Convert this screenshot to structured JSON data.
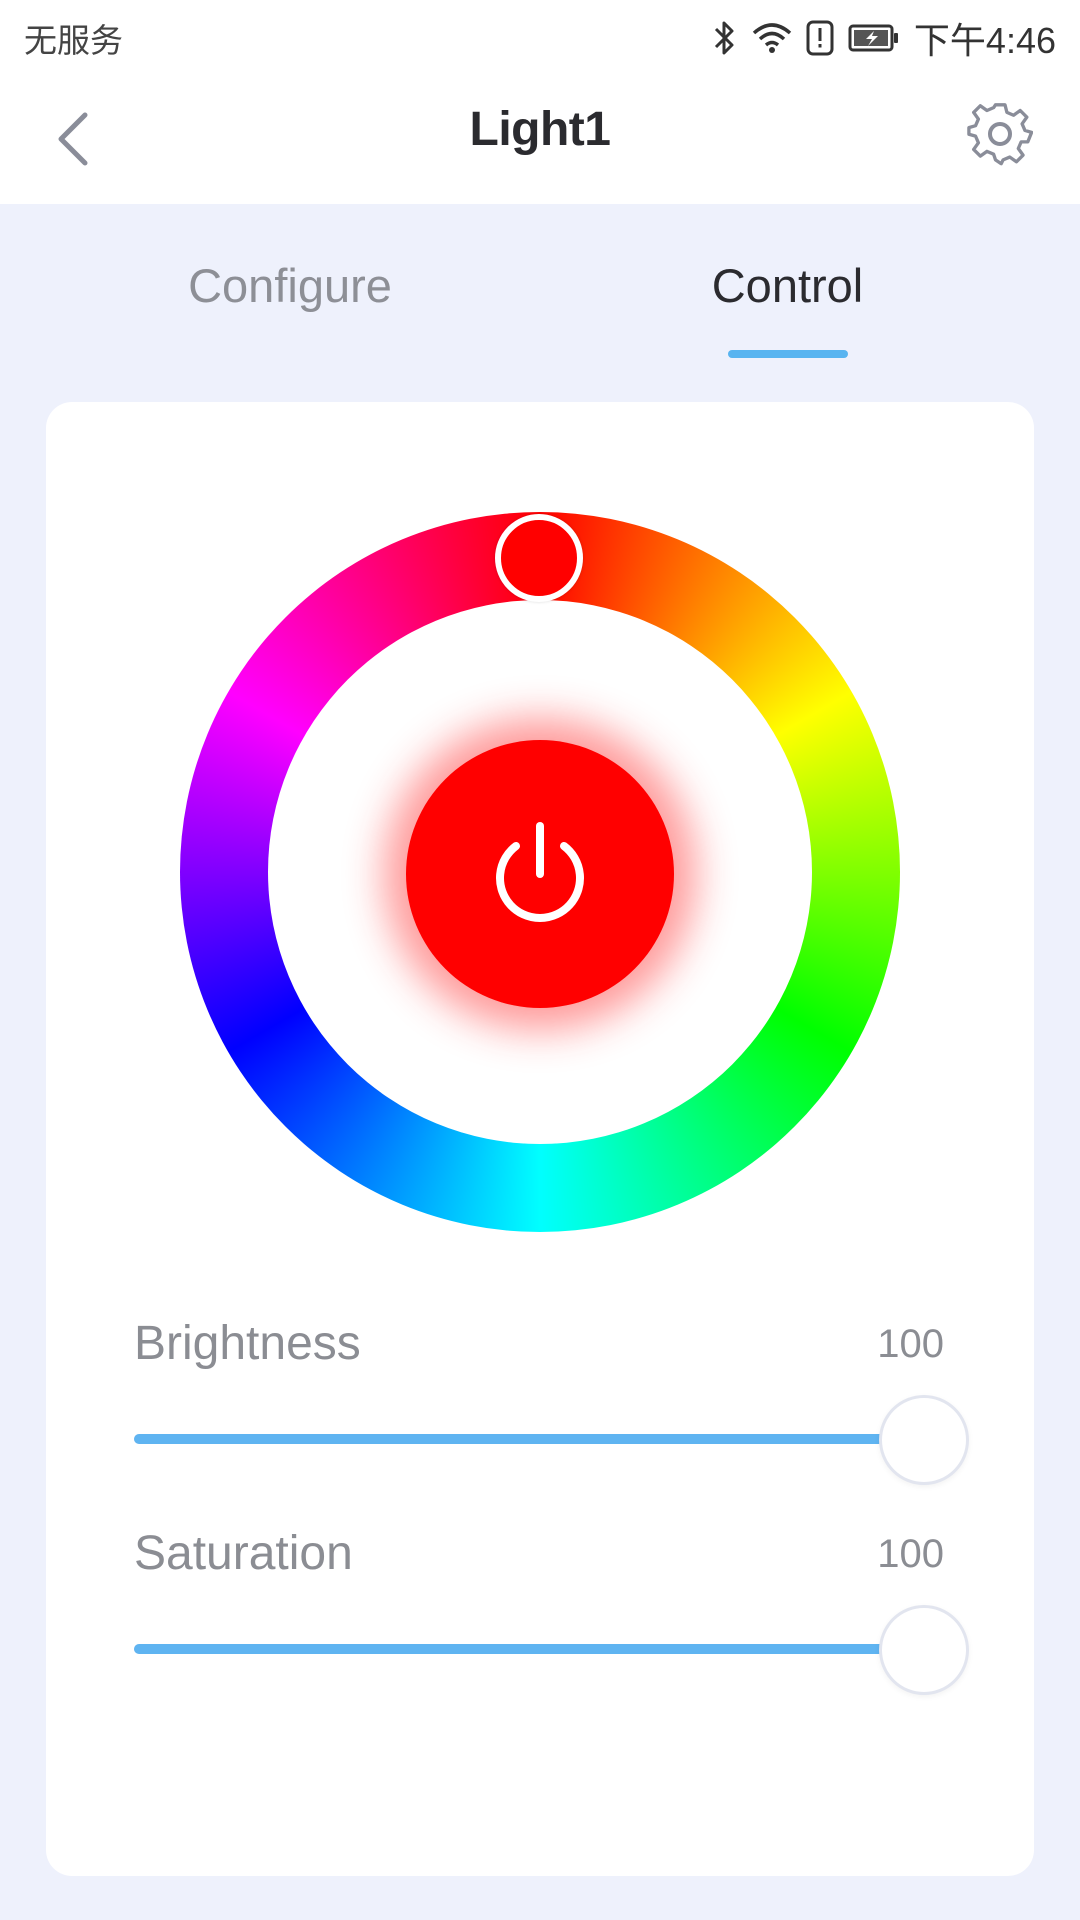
{
  "status_bar": {
    "carrier": "无服务",
    "time": "下午4:46",
    "icons": [
      "bluetooth-icon",
      "wifi-icon",
      "alert-icon",
      "battery-charging-icon"
    ]
  },
  "header": {
    "title": "Light1",
    "back_icon": "chevron-left-icon",
    "settings_icon": "gear-icon"
  },
  "tabs": [
    {
      "label": "Configure",
      "active": false
    },
    {
      "label": "Control",
      "active": true
    }
  ],
  "color_wheel": {
    "selected_color": "#ff0000",
    "power_icon": "power-icon"
  },
  "sliders": [
    {
      "label": "Brightness",
      "value": "100",
      "level": 1.0
    },
    {
      "label": "Saturation",
      "value": "100",
      "level": 1.0
    }
  ],
  "colors": {
    "accent": "#58b4f0",
    "background": "#eef1fc",
    "card": "#ffffff"
  }
}
